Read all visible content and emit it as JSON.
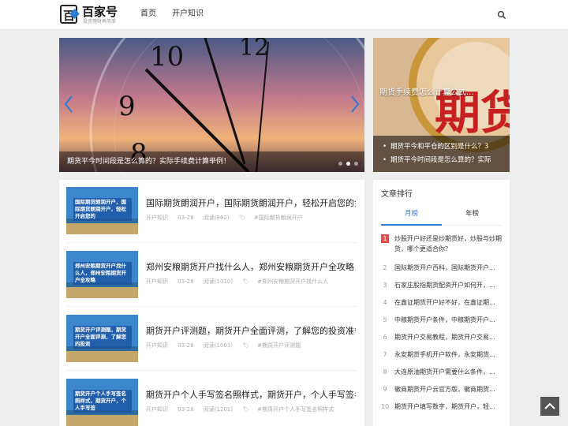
{
  "header": {
    "logo_text": "百家号",
    "logo_sub": "投资理财再简单",
    "nav": [
      "首页",
      "开户知识"
    ],
    "search_icon": "search-icon"
  },
  "banner": {
    "caption": "期货平今时间段是怎么算的？实际手续费计算举例！",
    "active_dot": 1
  },
  "side_feature": {
    "title": "期货手续费怎么计算公式...",
    "links": [
      "期货平今和平仓的区别是什么？3",
      "期货平今时间段是怎么算的？实际"
    ]
  },
  "articles": [
    {
      "thumb_text": "国际期货朗润开户，国际期货朗润开户，轻松开启您的",
      "title": "国际期货朗润开户，国际期货朗润开户，轻松开启您的金",
      "category": "开户知识",
      "date": "03-28",
      "views": "阅读(962)",
      "tag": "#国际期货朗润开户"
    },
    {
      "thumb_text": "郑州安粮期货开户找什么人，郑州安粮期货开户全攻略",
      "title": "郑州安粮期货开户找什么人，郑州安粮期货开户全攻略，",
      "category": "开户知识",
      "date": "03-28",
      "views": "阅读(1010)",
      "tag": "#郑州安粮期货开户找什么人"
    },
    {
      "thumb_text": "期货开户评测题，期货开户全面评测，了解您的投资",
      "title": "期货开户评测题，期货开户全面评测，了解您的投资准备",
      "category": "开户知识",
      "date": "03-28",
      "views": "阅读(1001)",
      "tag": "#期货开户评测题"
    },
    {
      "thumb_text": "期货开户个人手写签名照样式，期货开户，个人手写签",
      "title": "期货开户个人手写签名照样式，期货开户，个人手写签名",
      "category": "开户知识",
      "date": "03-28",
      "views": "阅读(1201)",
      "tag": "#期货开户个人手写签名照样式"
    }
  ],
  "ranking": {
    "title": "文章排行",
    "tabs": [
      "月榜",
      "年榜"
    ],
    "items": [
      "炒股开户好还是炒期货好，炒股与炒期货，哪个更适合你？",
      "国际期货开户百科，国际期货开户...",
      "石家庄股指期货配资开户如何开，...",
      "在鑫证期货开户好不好，在鑫证期...",
      "中粮期货开户条件，中粮期货开户...",
      "期货开户交易教程，期货开户交易...",
      "永安期货手机开户软件，永安期货...",
      "大连原油期货开户需要什么条件，...",
      "徽商期货开户云官方版，徽商期货...",
      "期货开户填写数字，期货开户，轻..."
    ]
  },
  "colors": {
    "accent": "#2c7bd6",
    "hot": "#e34d4d"
  }
}
